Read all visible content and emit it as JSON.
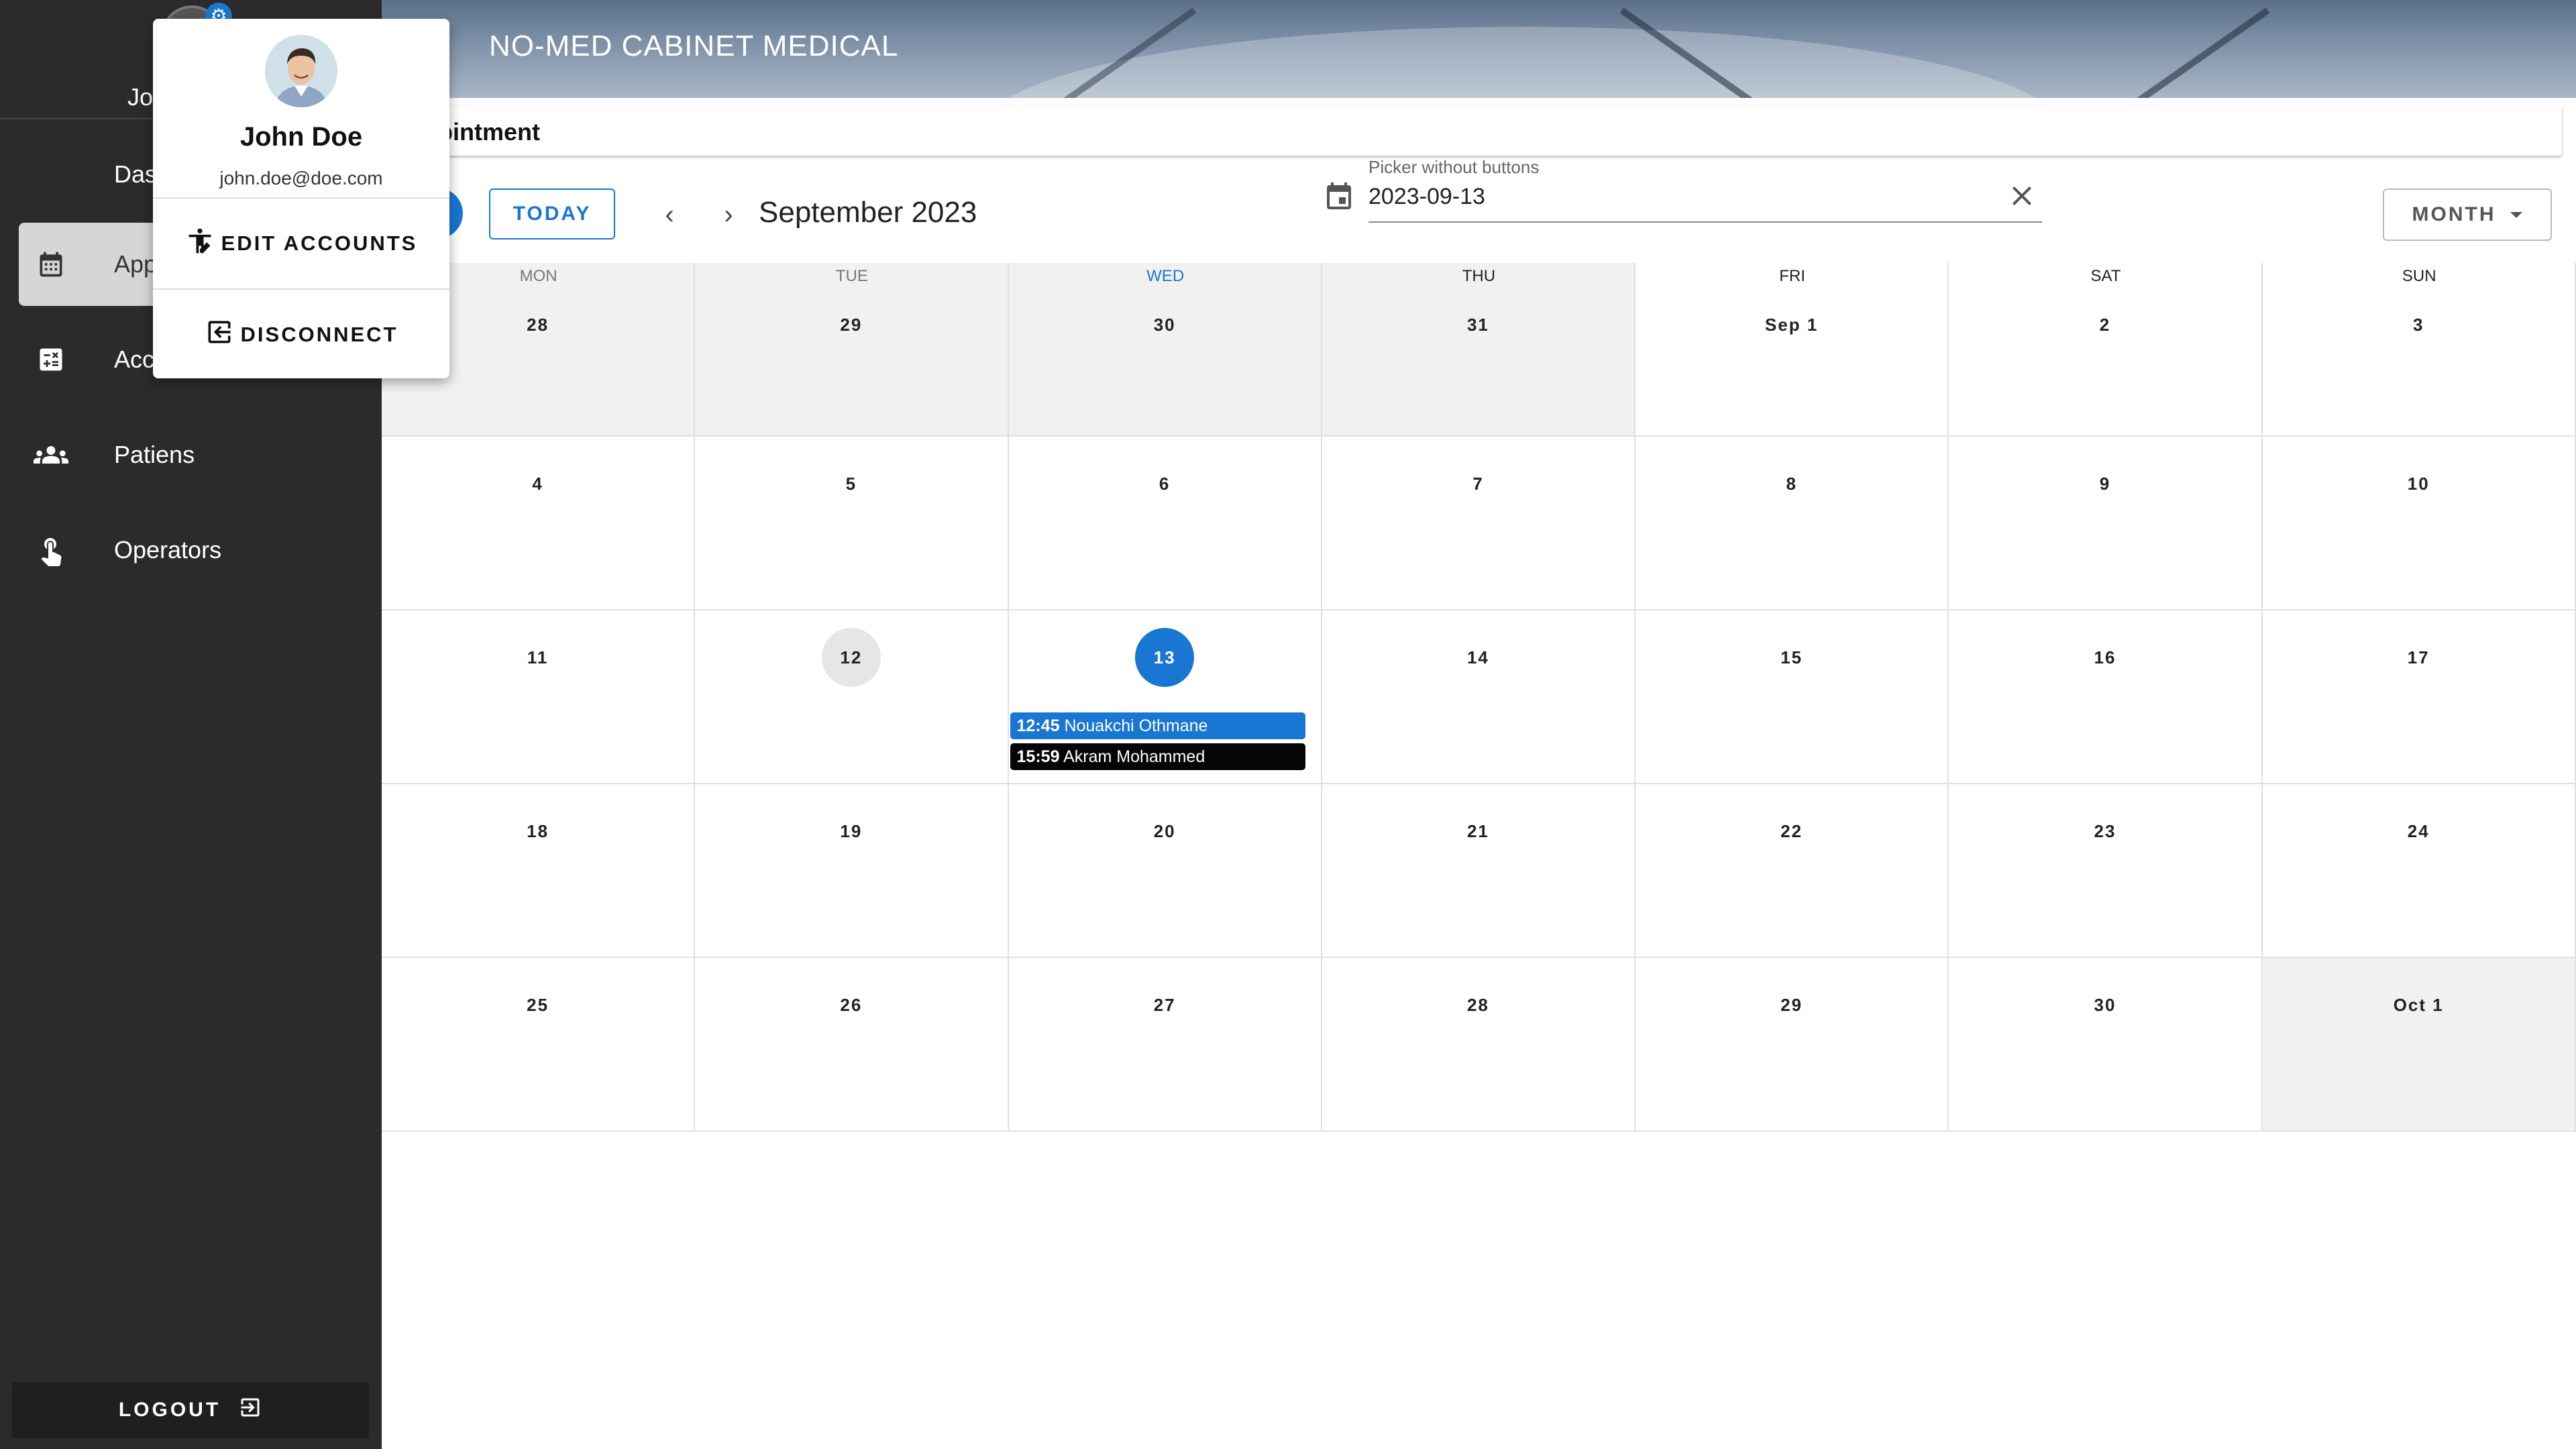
{
  "app": {
    "title": "NO-MED CABINET MEDICAL",
    "page_title": "pintment"
  },
  "sidebar": {
    "username": "Jo",
    "items": [
      {
        "label": "Das",
        "icon": "dashboard-icon"
      },
      {
        "label": "App",
        "icon": "calendar-icon",
        "active": true
      },
      {
        "label": "Acc",
        "icon": "calculator-icon"
      },
      {
        "label": "Patiens",
        "icon": "people-icon"
      },
      {
        "label": "Operators",
        "icon": "touch-icon"
      }
    ],
    "logout_label": "LOGOUT"
  },
  "popup": {
    "name": "John Doe",
    "email": "john.doe@doe.com",
    "edit_label": "EDIT ACCOUNTS",
    "disconnect_label": "DISCONNECT"
  },
  "toolbar": {
    "today_label": "TODAY",
    "month_title": "September 2023",
    "picker_label": "Picker without buttons",
    "picker_value": "2023-09-13",
    "view_label": "MONTH"
  },
  "calendar": {
    "weekdays": [
      "MON",
      "TUE",
      "WED",
      "THU",
      "FRI",
      "SAT",
      "SUN"
    ],
    "weeks": [
      [
        "28",
        "29",
        "30",
        "31",
        "Sep 1",
        "2",
        "3"
      ],
      [
        "4",
        "5",
        "6",
        "7",
        "8",
        "9",
        "10"
      ],
      [
        "11",
        "12",
        "13",
        "14",
        "15",
        "16",
        "17"
      ],
      [
        "18",
        "19",
        "20",
        "21",
        "22",
        "23",
        "24"
      ],
      [
        "25",
        "26",
        "27",
        "28",
        "29",
        "30",
        "Oct 1"
      ]
    ],
    "events": [
      {
        "time": "12:45",
        "name": "Nouakchi Othmane",
        "color": "#1976d2"
      },
      {
        "time": "15:59",
        "name": "Akram Mohammed",
        "color": "#050505"
      }
    ]
  },
  "colors": {
    "accent": "#1976d2",
    "sidebar": "#2b2b2b"
  }
}
